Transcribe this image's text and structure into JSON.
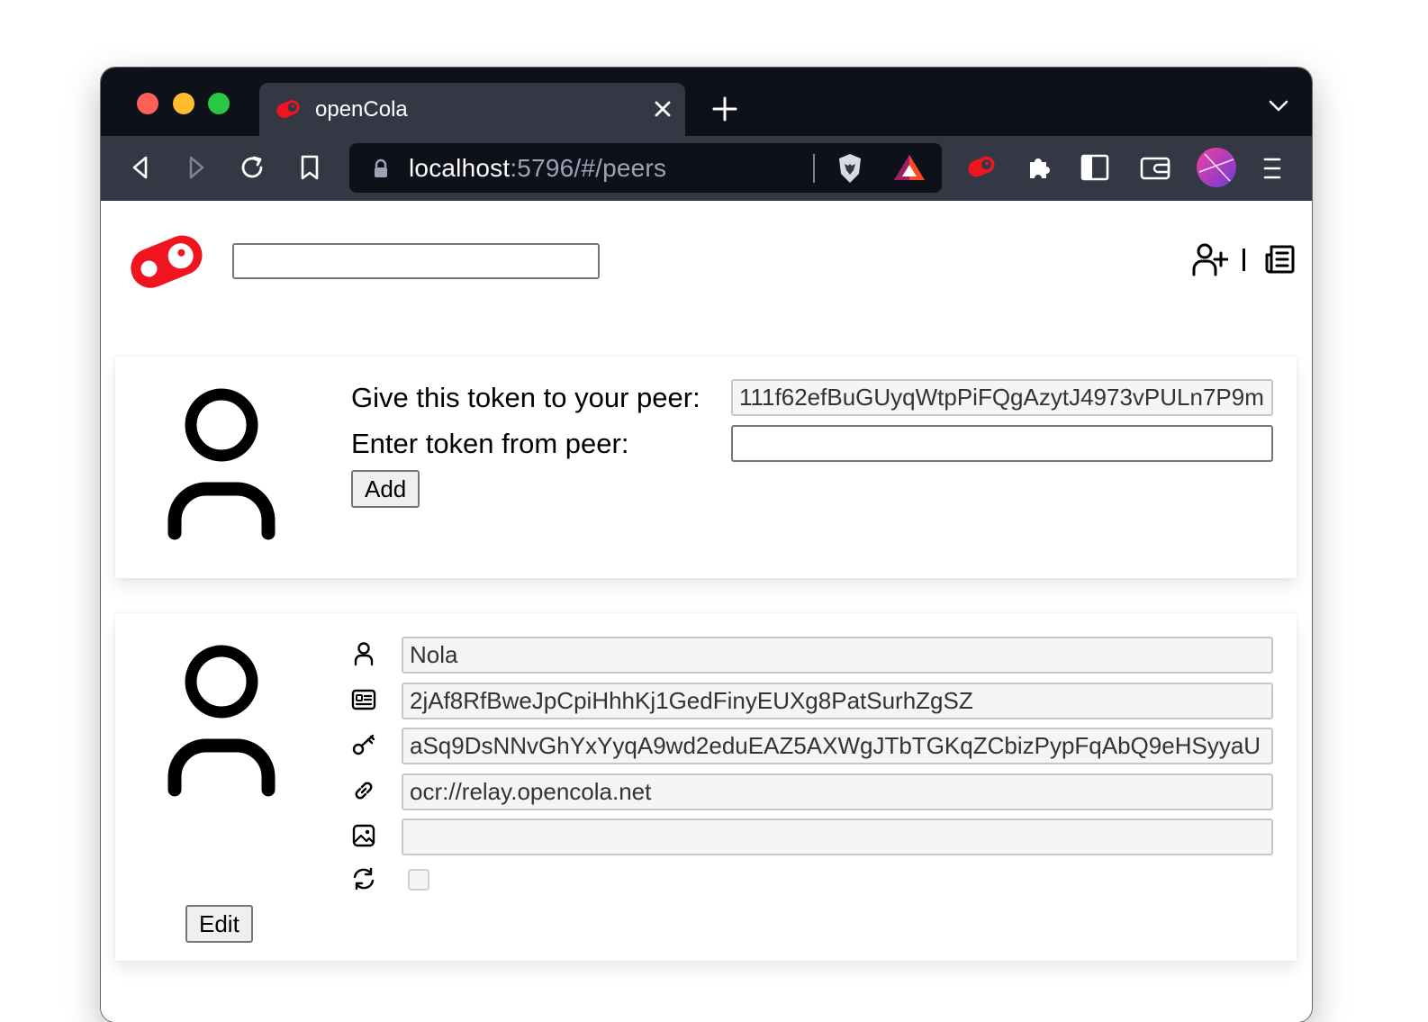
{
  "browser": {
    "tab_title": "openCola",
    "url_host": "localhost",
    "url_path": ":5796/#/peers"
  },
  "header": {
    "search_value": "",
    "icons": [
      "opencola-logo",
      "add-peer-icon",
      "feed-icon"
    ]
  },
  "token_card": {
    "give_label": "Give this token to your peer:",
    "token_value": "111f62efBuGUyqWtpPiFQgAzytJ4973vPULn7P9m",
    "enter_label": "Enter token from peer:",
    "enter_value": "",
    "add_button": "Add"
  },
  "peer_card": {
    "name": "Nola",
    "id": "2jAf8RfBweJpCpiHhhKj1GedFinyEUXg8PatSurhZgSZ",
    "public_key": "aSq9DsNNvGhYxYyqA9wd2eduEAZ5AXWgJTbTGKqZCbizPypFqAbQ9eHSyyaU",
    "address": "ocr://relay.opencola.net",
    "image_uri": "",
    "sync_enabled": false,
    "edit_button": "Edit"
  },
  "colors": {
    "brand_red": "#f0141e",
    "chrome_dark": "#0f111a",
    "toolbar": "#343845"
  }
}
